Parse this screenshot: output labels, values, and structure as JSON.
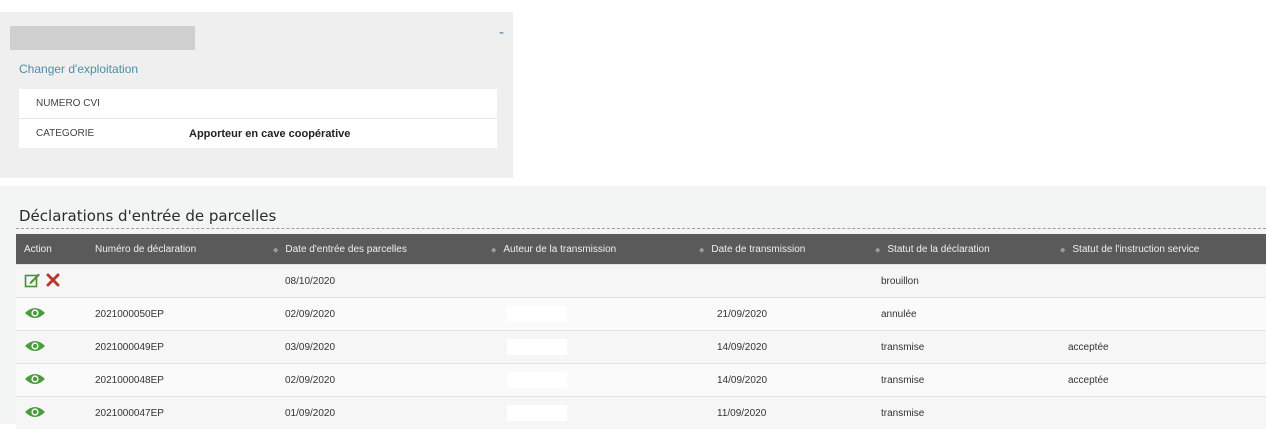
{
  "farm": {
    "collapse_symbol": "-",
    "change_link": "Changer d'exploitation",
    "rows": [
      {
        "label": "NUMERO CVI",
        "value": ""
      },
      {
        "label": "CATEGORIE",
        "value": "Apporteur en cave coopérative"
      }
    ]
  },
  "declarations": {
    "title": "Déclarations d'entrée de parcelles",
    "columns": [
      "Action",
      "Numéro de déclaration",
      "Date d'entrée des parcelles",
      "Auteur de la transmission",
      "Date de transmission",
      "Statut de la déclaration",
      "Statut de l'instruction service"
    ],
    "rows": [
      {
        "actions": [
          "edit-icon",
          "delete-icon"
        ],
        "numero": "",
        "date_entree": "08/10/2020",
        "auteur": "",
        "date_transmission": "",
        "statut": "brouillon",
        "statut_class": "st-draft",
        "instruction": ""
      },
      {
        "actions": [
          "view-icon"
        ],
        "numero": "2021000050EP",
        "date_entree": "02/09/2020",
        "auteur": "",
        "date_transmission": "21/09/2020",
        "statut": "annulée",
        "statut_class": "st-cancel",
        "instruction": ""
      },
      {
        "actions": [
          "view-icon"
        ],
        "numero": "2021000049EP",
        "date_entree": "03/09/2020",
        "auteur": "",
        "date_transmission": "14/09/2020",
        "statut": "transmise",
        "statut_class": "st-sent",
        "instruction": "acceptée"
      },
      {
        "actions": [
          "view-icon"
        ],
        "numero": "2021000048EP",
        "date_entree": "02/09/2020",
        "auteur": "",
        "date_transmission": "14/09/2020",
        "statut": "transmise",
        "statut_class": "st-sent",
        "instruction": "acceptée"
      },
      {
        "actions": [
          "view-icon"
        ],
        "numero": "2021000047EP",
        "date_entree": "01/09/2020",
        "auteur": "",
        "date_transmission": "11/09/2020",
        "statut": "transmise",
        "statut_class": "st-sent",
        "instruction": ""
      }
    ]
  },
  "colors": {
    "header_bg": "#5a5a5a",
    "link": "#4d8ea8",
    "draft": "#d9a72b",
    "sent": "#3a9132",
    "delete": "#b5392f"
  }
}
